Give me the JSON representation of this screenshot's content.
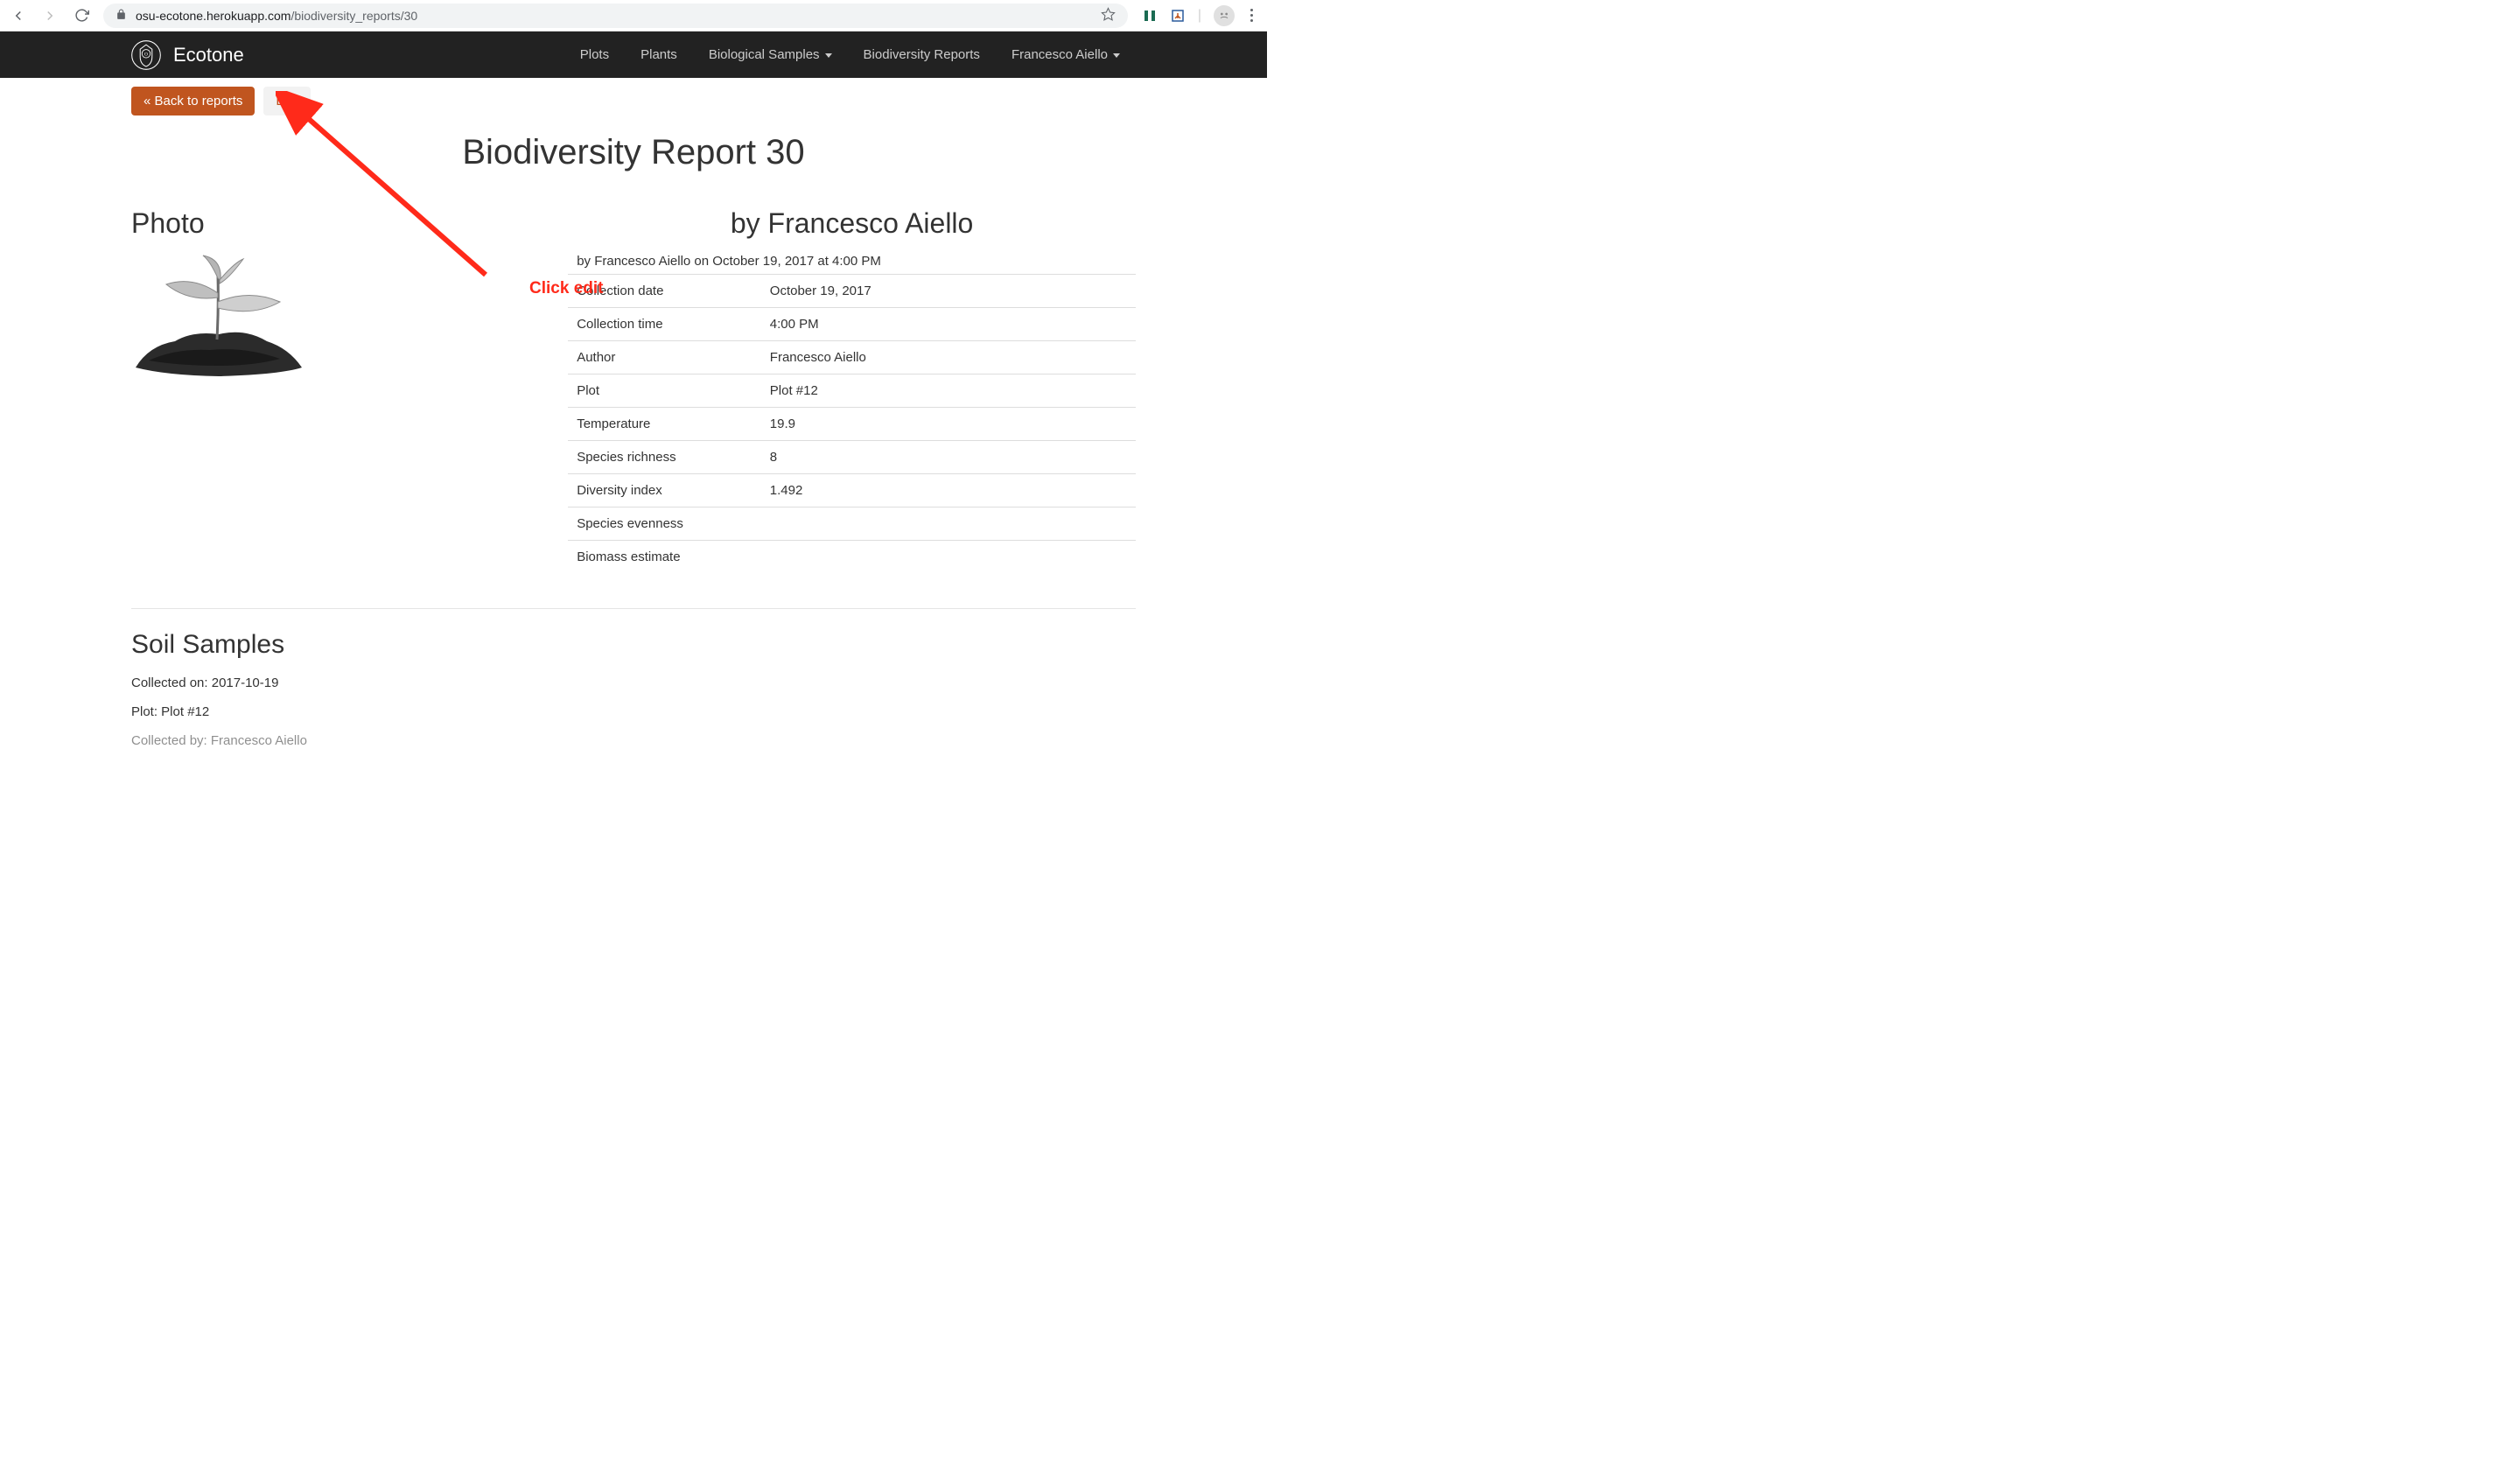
{
  "browser": {
    "url_host": "osu-ecotone.herokuapp.com",
    "url_path": "/biodiversity_reports/30"
  },
  "navbar": {
    "brand": "Ecotone",
    "links": [
      {
        "label": "Plots",
        "dropdown": false
      },
      {
        "label": "Plants",
        "dropdown": false
      },
      {
        "label": "Biological Samples",
        "dropdown": true
      },
      {
        "label": "Biodiversity Reports",
        "dropdown": false
      },
      {
        "label": "Francesco Aiello",
        "dropdown": true
      }
    ]
  },
  "actions": {
    "back_label": "« Back to reports",
    "edit_label": "Edit"
  },
  "page": {
    "title": "Biodiversity Report 30"
  },
  "photo": {
    "heading": "Photo"
  },
  "report": {
    "byline_heading": "by Francesco Aiello",
    "byline": "by Francesco Aiello on October 19, 2017 at 4:00 PM",
    "rows": [
      {
        "label": "Collection date",
        "value": "October 19, 2017"
      },
      {
        "label": "Collection time",
        "value": "4:00 PM"
      },
      {
        "label": "Author",
        "value": "Francesco Aiello"
      },
      {
        "label": "Plot",
        "value": "Plot #12"
      },
      {
        "label": "Temperature",
        "value": "19.9"
      },
      {
        "label": "Species richness",
        "value": "8"
      },
      {
        "label": "Diversity index",
        "value": "1.492"
      },
      {
        "label": "Species evenness",
        "value": ""
      },
      {
        "label": "Biomass estimate",
        "value": ""
      }
    ]
  },
  "soil": {
    "heading": "Soil Samples",
    "collected_on": "Collected on: 2017-10-19",
    "plot": "Plot: Plot #12",
    "collected_by": "Collected by: Francesco Aiello"
  },
  "annotation": {
    "label": "Click edit"
  }
}
